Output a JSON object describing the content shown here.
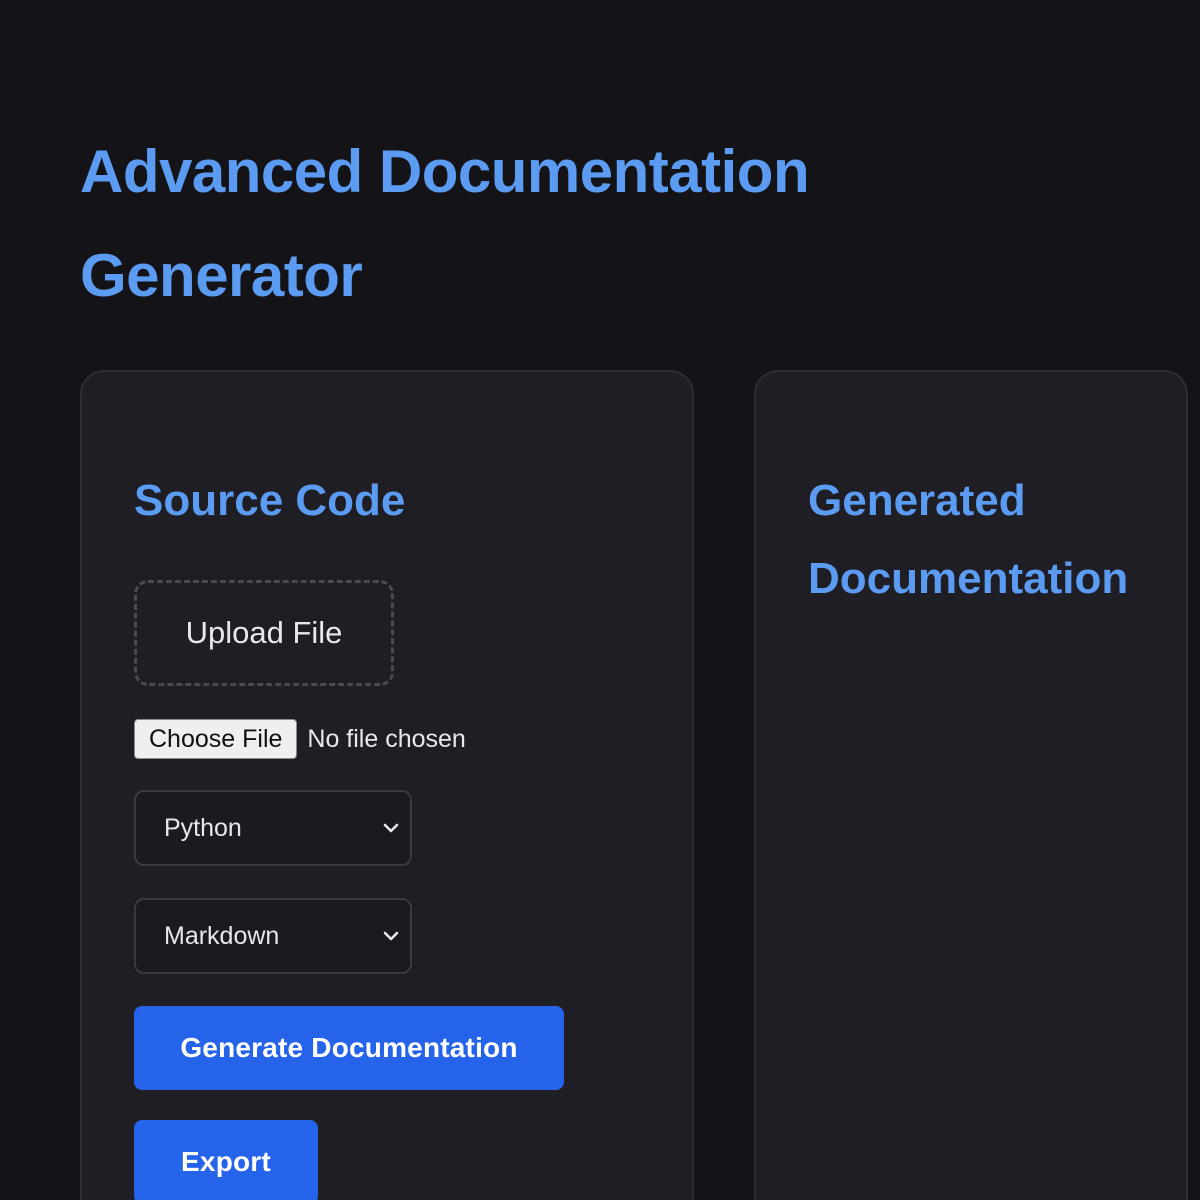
{
  "page": {
    "title": "Advanced Documentation Generator"
  },
  "source_panel": {
    "heading": "Source Code",
    "upload_label": "Upload File",
    "file_input": {
      "button_label": "Choose File",
      "status": "No file chosen"
    },
    "language_select": {
      "selected": "Python",
      "icon": "chevron-down-icon"
    },
    "format_select": {
      "selected": "Markdown",
      "icon": "chevron-down-icon"
    },
    "generate_label": "Generate Documentation",
    "export_label": "Export"
  },
  "output_panel": {
    "heading": "Generated Documentation"
  },
  "colors": {
    "background": "#141418",
    "card": "#1e1e24",
    "accent_text": "#5b9cf2",
    "primary_button": "#2563eb"
  }
}
